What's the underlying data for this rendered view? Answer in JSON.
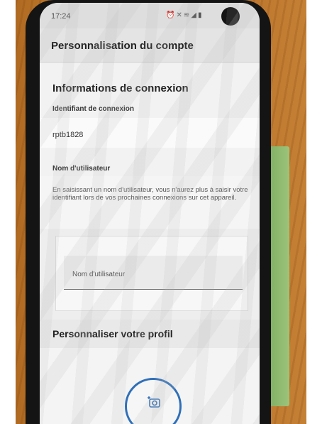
{
  "status_bar": {
    "time": "17:24",
    "icons": [
      "alarm-icon",
      "mute-icon",
      "wifi-icon",
      "signal-icon",
      "battery-icon"
    ]
  },
  "app_bar": {
    "title": "Personnalisation du compte"
  },
  "login_info": {
    "section_title": "Informations de connexion",
    "identifier_label": "Identifiant de connexion",
    "identifier_value": "rptb1828"
  },
  "username": {
    "label": "Nom d'utilisateur",
    "description": "En saisissant un nom d'utilisateur, vous n'aurez plus à saisir votre identifiant lors de vos prochaines connexions sur cet appareil.",
    "input_placeholder": "Nom d'utilisateur",
    "input_value": ""
  },
  "profile": {
    "section_title": "Personnaliser votre profil",
    "photo_button_icon": "add-photo-icon"
  },
  "colors": {
    "accent": "#2f6fb8",
    "background": "#ececec"
  }
}
